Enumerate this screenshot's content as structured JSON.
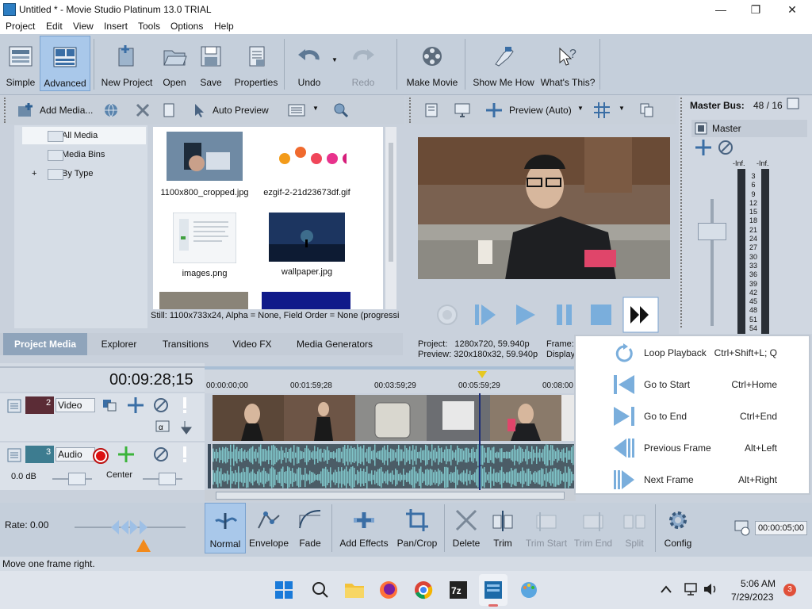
{
  "window": {
    "title": "Untitled * - Movie Studio Platinum 13.0 TRIAL",
    "min": "—",
    "max": "❐",
    "close": "✕"
  },
  "menu": [
    "Project",
    "Edit",
    "View",
    "Insert",
    "Tools",
    "Options",
    "Help"
  ],
  "toolbar": {
    "simple": "Simple",
    "advanced": "Advanced",
    "new_project": "New Project",
    "open": "Open",
    "save": "Save",
    "properties": "Properties",
    "undo": "Undo",
    "redo": "Redo",
    "make_movie": "Make Movie",
    "show_me_how": "Show Me How",
    "whats_this": "What's This?"
  },
  "media": {
    "add_media": "Add Media...",
    "auto_preview": "Auto Preview",
    "tree": [
      "All Media",
      "Media Bins",
      "By Type"
    ],
    "tree_expander": "+",
    "files": [
      "1100x800_cropped.jpg",
      "ezgif-2-21d23673df.gif",
      "images.png",
      "wallpaper.jpg"
    ],
    "status": "Still: 1100x733x24, Alpha = None, Field Order = None (progressi"
  },
  "tabs": [
    "Project Media",
    "Explorer",
    "Transitions",
    "Video FX",
    "Media Generators"
  ],
  "preview": {
    "mode": "Preview (Auto)",
    "project_label": "Project:",
    "project_value": "1280x720, 59.940p",
    "preview_label": "Preview:",
    "preview_value": "320x180x32, 59.940p",
    "frame_label": "Frame:",
    "display_label": "Display"
  },
  "mixer": {
    "title": "Master Bus:",
    "value": "48 / 16",
    "master": "Master",
    "inf1": "-Inf.",
    "inf2": "-Inf.",
    "scale": [
      "3",
      "6",
      "9",
      "12",
      "15",
      "18",
      "21",
      "24",
      "27",
      "30",
      "33",
      "36",
      "39",
      "42",
      "45",
      "48",
      "51",
      "54"
    ]
  },
  "timeline": {
    "timecode": "00:09:28;15",
    "ruler": [
      "00:00:00;00",
      "00:01:59;28",
      "00:03:59;29",
      "00:05:59;29",
      "00:08:00"
    ]
  },
  "tracks": {
    "video": {
      "number": "2",
      "name": "Video"
    },
    "audio": {
      "number": "3",
      "name": "Audio",
      "volume": "0.0 dB",
      "pan": "Center"
    }
  },
  "popup": [
    {
      "label": "Loop Playback",
      "key": "Ctrl+Shift+L; Q"
    },
    {
      "label": "Go to Start",
      "key": "Ctrl+Home"
    },
    {
      "label": "Go to End",
      "key": "Ctrl+End"
    },
    {
      "label": "Previous Frame",
      "key": "Alt+Left"
    },
    {
      "label": "Next Frame",
      "key": "Alt+Right"
    }
  ],
  "bottom": {
    "rate": "Rate: 0.00",
    "normal": "Normal",
    "envelope": "Envelope",
    "fade": "Fade",
    "add_effects": "Add Effects",
    "pan_crop": "Pan/Crop",
    "delete": "Delete",
    "trim": "Trim",
    "trim_start": "Trim Start",
    "trim_end": "Trim End",
    "split": "Split",
    "config": "Config",
    "duration": "00:00:05;00"
  },
  "statusbar": "Move one frame right.",
  "taskbar": {
    "time": "5:06 AM",
    "date": "7/29/2023",
    "badge": "3"
  }
}
